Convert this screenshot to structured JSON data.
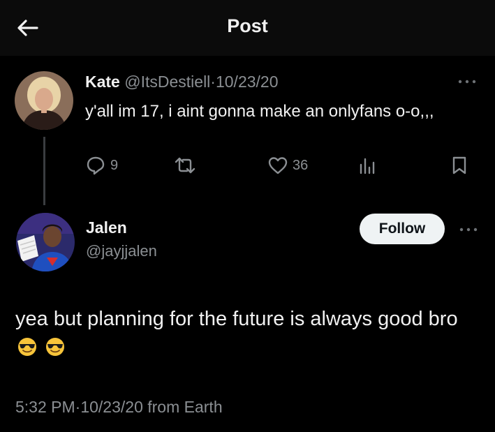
{
  "header": {
    "title": "Post",
    "back_icon": "arrow-left-icon"
  },
  "reply": {
    "name": "Kate",
    "handle": "@ItsDestiell",
    "separator": "·",
    "date": "10/23/20",
    "text": "y'all im 17, i aint gonna make an onlyfans o-o,,,",
    "stats": {
      "replies": "9",
      "retweets": "",
      "likes": "36"
    }
  },
  "post": {
    "name": "Jalen",
    "handle": "@jayjjalen",
    "follow_label": "Follow",
    "text": "yea but planning for the future is always good bro",
    "emojis": [
      "sunglasses-emoji",
      "sunglasses-emoji"
    ],
    "time": "5:32 PM",
    "separator": "·",
    "date": "10/23/20",
    "source": "from Earth"
  },
  "colors": {
    "background": "#000000",
    "muted": "#8b8f93",
    "text": "#f1f1f1",
    "follow_bg": "#eff3f4"
  }
}
